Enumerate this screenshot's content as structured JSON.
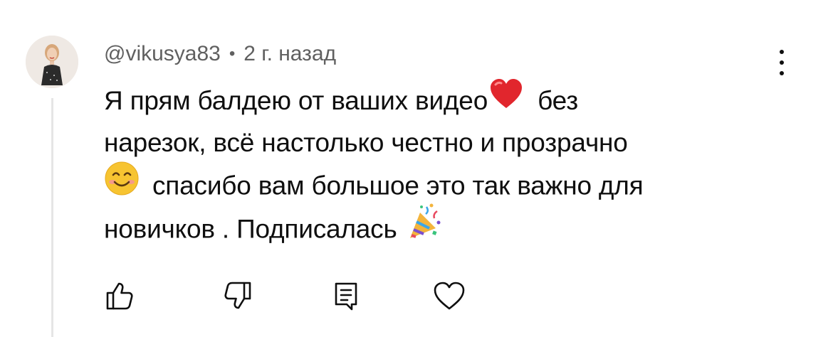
{
  "comment": {
    "author": "@vikusya83",
    "separator": "•",
    "time": "2 г. назад",
    "lines": [
      "Я прям балдею от ваших видео",
      "без",
      "нарезок, всё настолько честно и прозрачно",
      "спасибо вам большое это так важно для",
      "новичков . Подписалась"
    ],
    "emojis": [
      "heart-emoji",
      "smiling-face-emoji",
      "party-popper-emoji"
    ]
  },
  "actions": {
    "icons": [
      "thumbs-up-icon",
      "thumbs-down-icon",
      "reply-icon",
      "heart-outline-icon"
    ]
  },
  "menu": {
    "icon": "more-vertical-icon"
  },
  "colors": {
    "text": "#0f0f0f",
    "meta": "#606060",
    "thread_line": "#e5e5e5",
    "heart": "#e1262d",
    "smile": "#f7c431"
  }
}
